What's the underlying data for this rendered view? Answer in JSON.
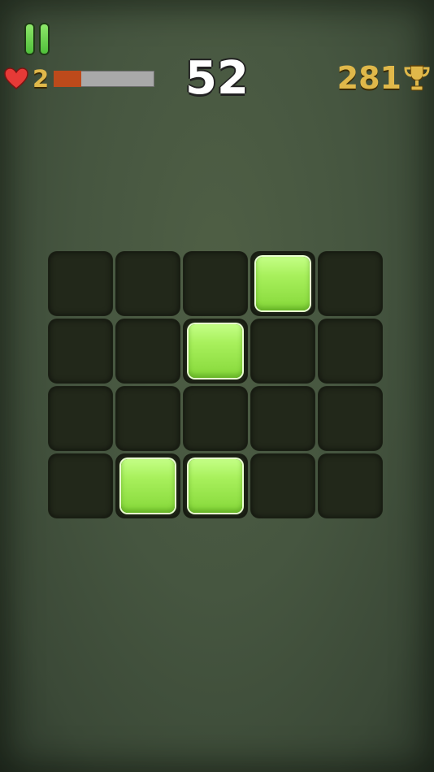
{
  "hud": {
    "lives": "2",
    "life_progress": 0.27,
    "score": "52",
    "best_score": "281"
  },
  "colors": {
    "accent": "#a8f05c",
    "heart": "#e63a37",
    "gold": "#e0b84a",
    "life_fill": "#bd4a1b"
  },
  "icons": [
    "pause-icon",
    "heart-icon",
    "trophy-icon"
  ],
  "grid": {
    "rows": 4,
    "cols": 5,
    "cells": [
      [
        false,
        false,
        false,
        true,
        false
      ],
      [
        false,
        false,
        true,
        false,
        false
      ],
      [
        false,
        false,
        false,
        false,
        false
      ],
      [
        false,
        true,
        true,
        false,
        false
      ]
    ]
  }
}
